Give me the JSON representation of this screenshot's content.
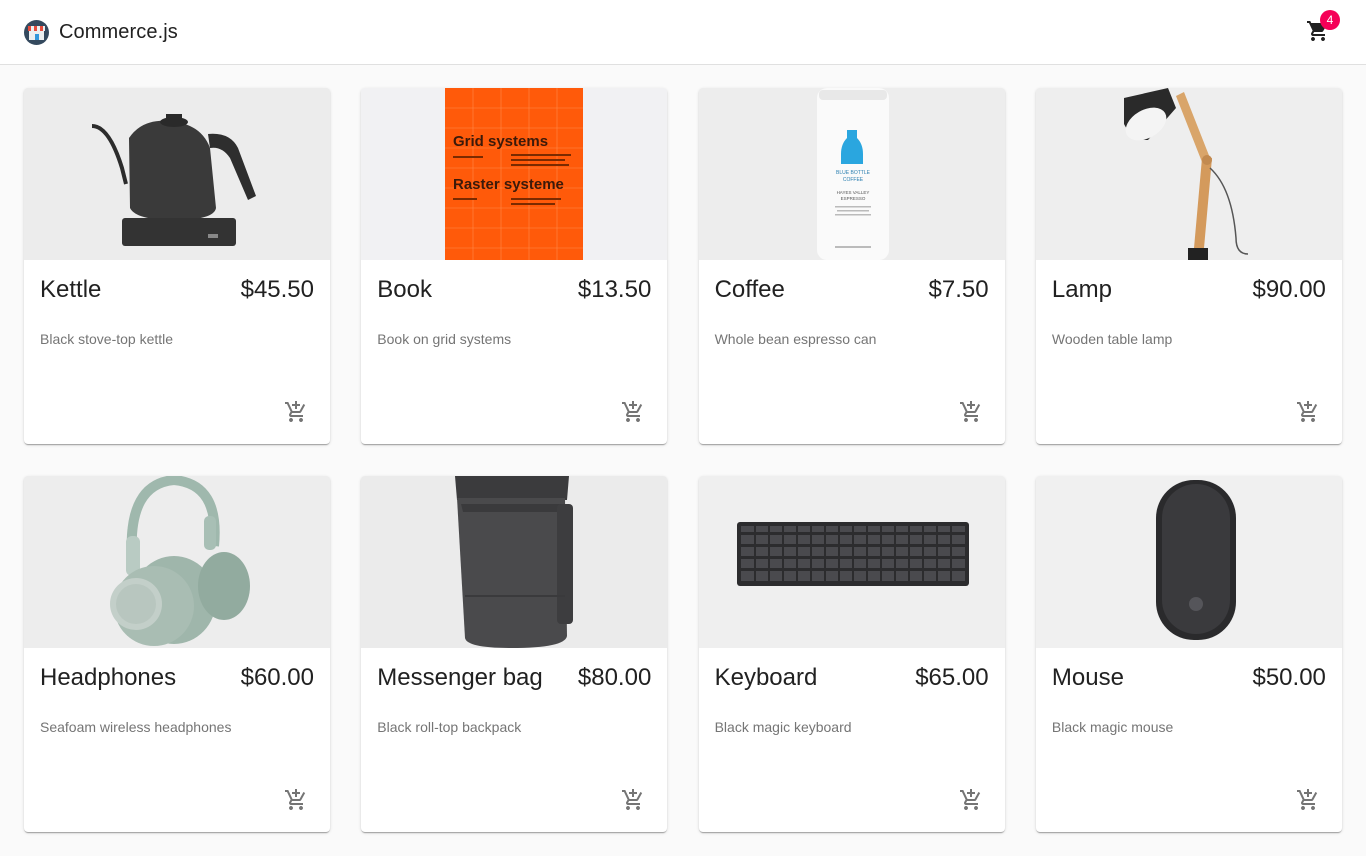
{
  "app": {
    "name": "Commerce.js",
    "logo_icon": "store-logo-icon"
  },
  "cart": {
    "icon": "shopping-cart-icon",
    "count": "4",
    "badge_color": "#f50057"
  },
  "add_to_cart_icon": "add-shopping-cart-icon",
  "products": [
    {
      "name": "Kettle",
      "price": "$45.50",
      "description": "Black stove-top kettle"
    },
    {
      "name": "Book",
      "price": "$13.50",
      "description": "Book on grid systems",
      "cover": {
        "title1": "Grid systems",
        "title2": "Raster systeme"
      }
    },
    {
      "name": "Coffee",
      "price": "$7.50",
      "description": "Whole bean espresso can",
      "label": {
        "brand1": "BLUE BOTTLE",
        "brand2": "COFFEE",
        "line1": "HAYES VALLEY",
        "line2": "ESPRESSO"
      }
    },
    {
      "name": "Lamp",
      "price": "$90.00",
      "description": "Wooden table lamp"
    },
    {
      "name": "Headphones",
      "price": "$60.00",
      "description": "Seafoam wireless headphones"
    },
    {
      "name": "Messenger bag",
      "price": "$80.00",
      "description": "Black roll-top backpack"
    },
    {
      "name": "Keyboard",
      "price": "$65.00",
      "description": "Black magic keyboard"
    },
    {
      "name": "Mouse",
      "price": "$50.00",
      "description": "Black magic mouse"
    }
  ]
}
